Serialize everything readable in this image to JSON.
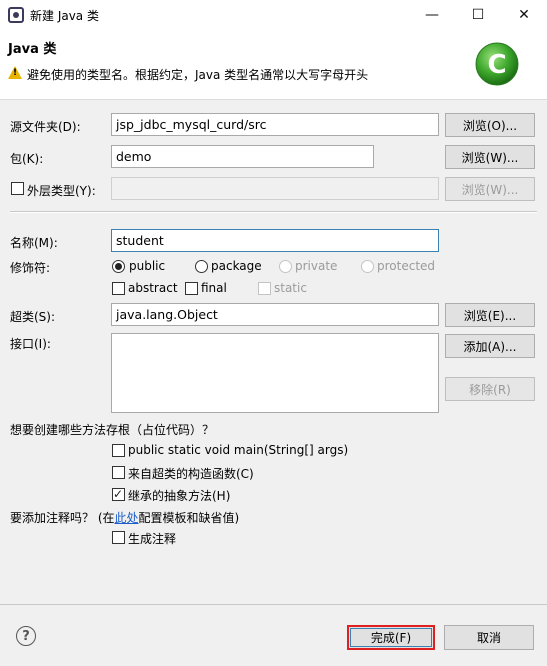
{
  "window": {
    "title": "新建 Java 类",
    "minimize_glyph": "—",
    "maximize_glyph": "☐",
    "close_glyph": "✕"
  },
  "banner": {
    "title": "Java 类",
    "message": "避免使用的类型名。根据约定，Java 类型名通常以大写字母开头",
    "logo_letter": "C"
  },
  "source_folder": {
    "label": "源文件夹(D):",
    "value": "jsp_jdbc_mysql_curd/src",
    "browse": "浏览(O)..."
  },
  "package": {
    "label": "包(K):",
    "value": "demo",
    "browse": "浏览(W)..."
  },
  "enclosing_type": {
    "label": "外层类型(Y):",
    "value": "",
    "browse": "浏览(W)...",
    "checked": false
  },
  "name": {
    "label": "名称(M):",
    "value": "student"
  },
  "modifiers": {
    "label": "修饰符:",
    "public": "public",
    "package": "package",
    "private": "private",
    "protected": "protected",
    "abstract": "abstract",
    "final": "final",
    "static": "static",
    "selected": "public"
  },
  "superclass": {
    "label": "超类(S):",
    "value": "java.lang.Object",
    "browse": "浏览(E)..."
  },
  "interfaces": {
    "label": "接口(I):",
    "add": "添加(A)...",
    "remove": "移除(R)"
  },
  "stubs": {
    "question": "想要创建哪些方法存根（占位代码）？",
    "main": "public static void main(String[] args)",
    "constructors": "来自超类的构造函数(C)",
    "inherited": "继承的抽象方法(H)",
    "main_checked": false,
    "constructors_checked": false,
    "inherited_checked": true
  },
  "comments": {
    "question_prefix": "要添加注释吗？ (在",
    "link": "此处",
    "question_suffix": "配置模板和缺省值)",
    "generate": "生成注释",
    "generate_checked": false
  },
  "footer": {
    "help": "?",
    "finish": "完成(F)",
    "cancel": "取消"
  },
  "colors": {
    "accent_red": "#e02020",
    "logo_green": "#3aa52a",
    "warning_yellow": "#e8b400"
  }
}
